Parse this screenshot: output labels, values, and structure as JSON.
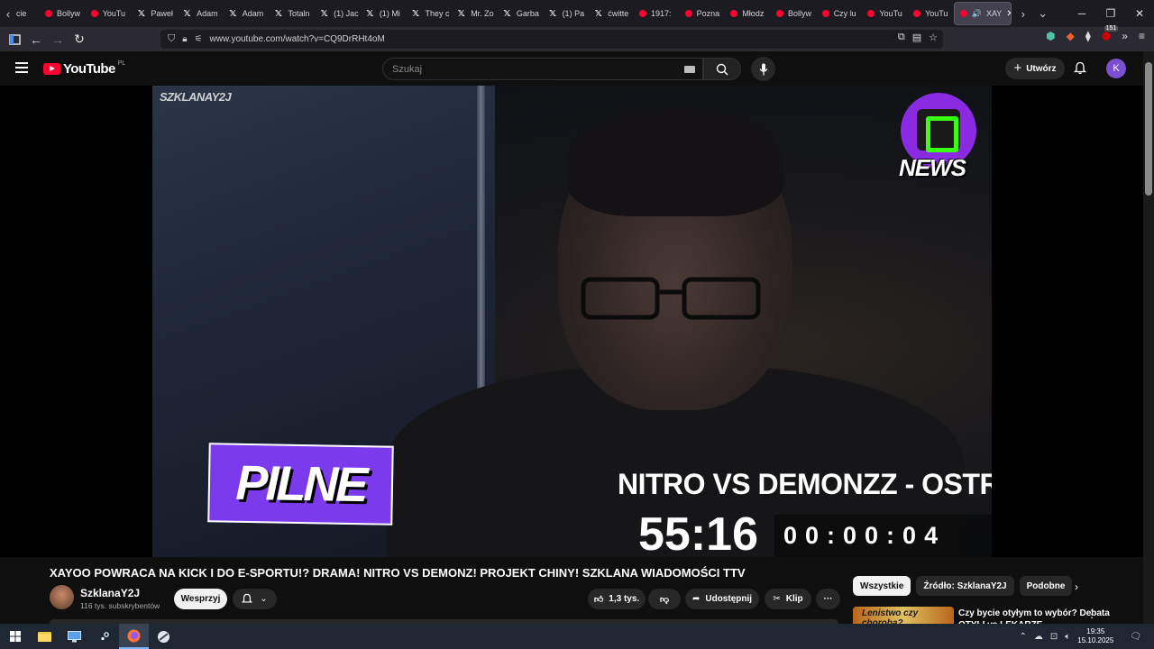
{
  "browser": {
    "tabs": [
      {
        "label": "Bollyw",
        "icon": "youtube"
      },
      {
        "label": "YouTu",
        "icon": "youtube"
      },
      {
        "label": "Paweł",
        "icon": "x"
      },
      {
        "label": "Adam",
        "icon": "x"
      },
      {
        "label": "Adam",
        "icon": "x"
      },
      {
        "label": "Totaln",
        "icon": "x"
      },
      {
        "label": "(1) Jac",
        "icon": "x"
      },
      {
        "label": "(1) Mi",
        "icon": "x"
      },
      {
        "label": "They c",
        "icon": "x"
      },
      {
        "label": "Mr. Zo",
        "icon": "x"
      },
      {
        "label": "Garba",
        "icon": "x"
      },
      {
        "label": "(1) Pa",
        "icon": "x"
      },
      {
        "label": "ćwitte",
        "icon": "x"
      },
      {
        "label": "1917:",
        "icon": "youtube"
      },
      {
        "label": "Pozna",
        "icon": "youtube"
      },
      {
        "label": "Młodz",
        "icon": "youtube"
      },
      {
        "label": "Bollyw",
        "icon": "youtube"
      },
      {
        "label": "Czy lu",
        "icon": "youtube"
      },
      {
        "label": "YouTu",
        "icon": "youtube"
      },
      {
        "label": "YouTu",
        "icon": "youtube"
      }
    ],
    "first_tab_fragment": "cie",
    "active_tab": {
      "label": "XAY",
      "close": "✕"
    },
    "url": "www.youtube.com/watch?v=CQ9DrRHt4oM",
    "extension_badge": "151"
  },
  "youtube": {
    "logo_text": "YouTube",
    "region": "PL",
    "search_placeholder": "Szukaj",
    "create_label": "Utwórz",
    "avatar_letter": "K"
  },
  "video": {
    "watermark": "SZKLANAY2J",
    "news_label": "NEWS",
    "pilne_label": "PILNE",
    "ticker_text": "NITRO VS DEMONZZ - OSTRA DI",
    "timer_big": "55:16",
    "timer_small": "00:00:04"
  },
  "details": {
    "title": "XAYOO POWRACA NA KICK I DO E-SPORTU!? DRAMA! NITRO VS DEMONZ! PROJEKT CHINY! SZKLANA WIADOMOŚCI TTV",
    "channel_name": "SzklanaY2J",
    "subscribers": "116 tys. subskrybentów",
    "support_label": "Wesprzyj",
    "likes": "1,3 tys.",
    "share_label": "Udostępnij",
    "clip_label": "Klip",
    "more_label": "···"
  },
  "recommendations": {
    "chips": [
      "Wszystkie",
      "Źródło: SzklanaY2J",
      "Podobne"
    ],
    "first_title": "Czy bycie otyłym to wybór? Debata OTYLI vs LEKARZE",
    "first_thumb_text": "Lenistwo czy choroba?"
  },
  "taskbar": {
    "time": "19:35",
    "date": "15.10.2025"
  },
  "colors": {
    "youtube_red": "#ff0033",
    "pilne_purple": "#7c3aed",
    "news_green": "#39ff14"
  }
}
